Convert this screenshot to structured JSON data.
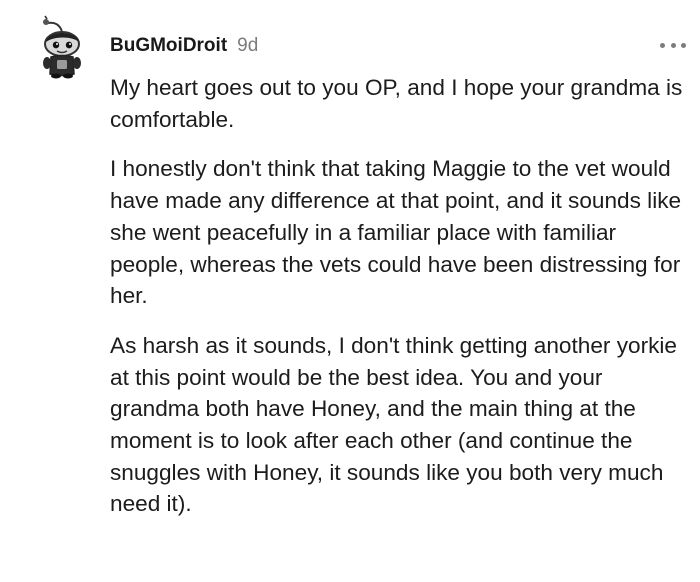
{
  "comment": {
    "username": "BuGMoiDroit",
    "timestamp": "9d",
    "avatar_icon": "snoo-avatar-icon",
    "more_icon": "more-options-icon",
    "paragraphs": [
      "My heart goes out to you OP, and I hope your grandma is comfortable.",
      "I honestly don't think that taking Maggie to the vet would have made any difference at that point, and it sounds like she went peacefully in a familiar place with familiar people, whereas the vets could have been distressing for her.",
      "As harsh as it sounds, I don't think getting another yorkie at this point would be the best idea. You and your grandma both have Honey, and the main thing at the moment is to look after each other (and continue the snuggles with Honey, it sounds like you both very much need it)."
    ]
  },
  "colors": {
    "text": "#1c1c1c",
    "meta": "#7c7c7c"
  }
}
